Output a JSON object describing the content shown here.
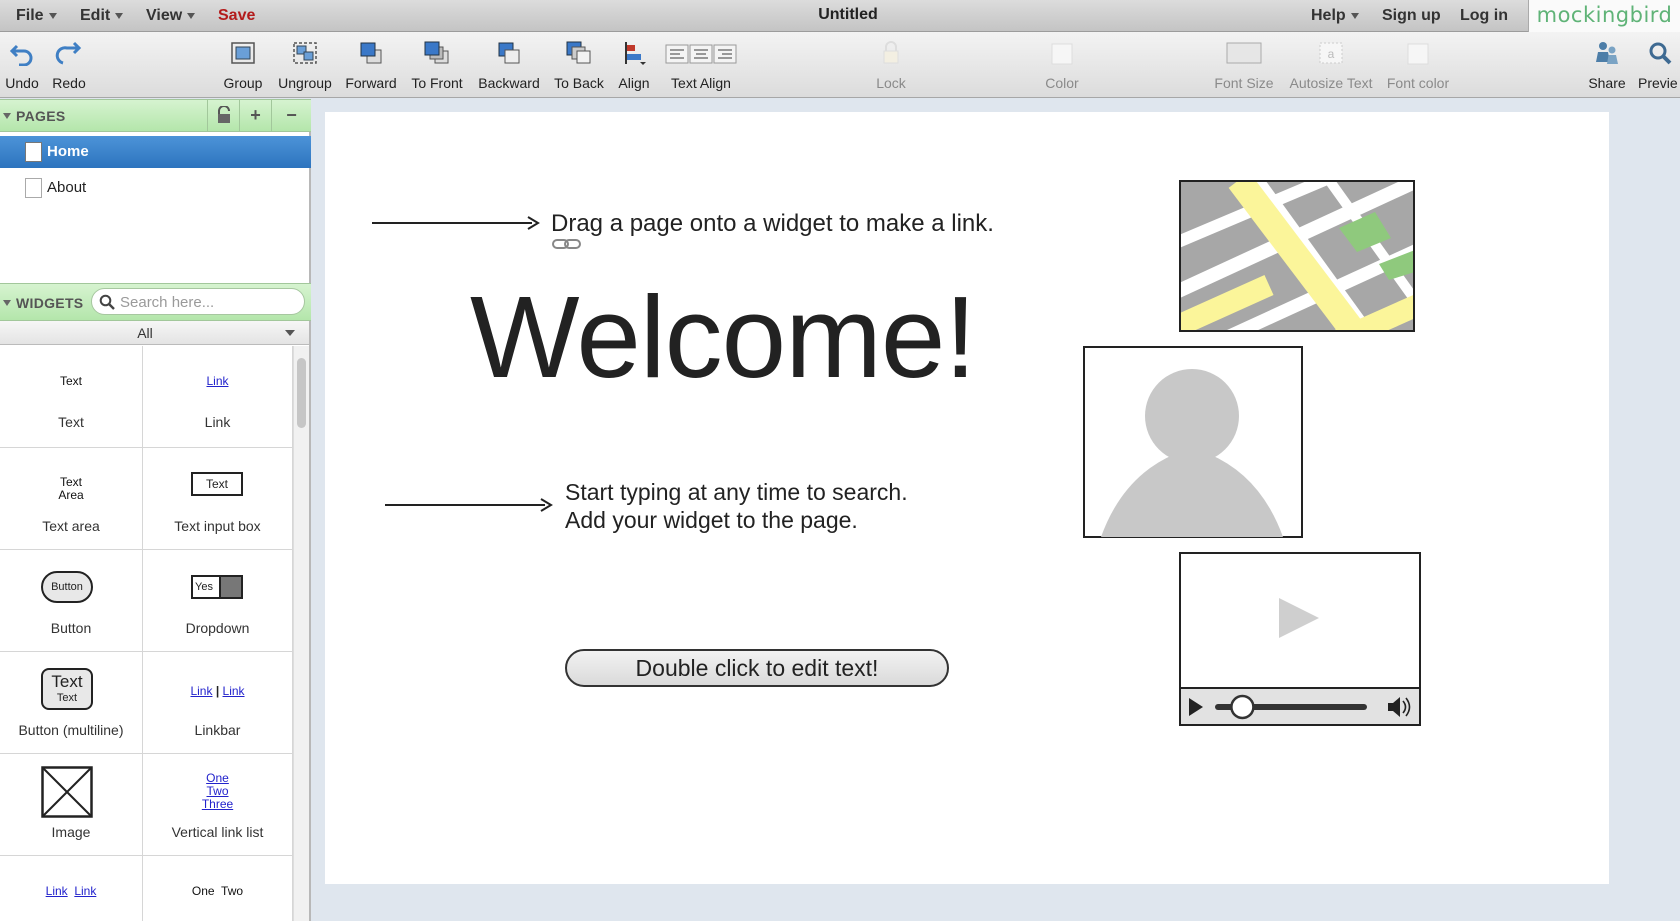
{
  "menubar": {
    "file": "File",
    "edit": "Edit",
    "view": "View",
    "save": "Save",
    "title": "Untitled",
    "help": "Help",
    "signup": "Sign up",
    "login": "Log in",
    "brand": "mockingbird"
  },
  "toolbar": {
    "undo": "Undo",
    "redo": "Redo",
    "group": "Group",
    "ungroup": "Ungroup",
    "forward": "Forward",
    "to_front": "To Front",
    "backward": "Backward",
    "to_back": "To Back",
    "align": "Align",
    "text_align": "Text Align",
    "lock": "Lock",
    "color": "Color",
    "font_size": "Font Size",
    "autosize_text": "Autosize Text",
    "font_color": "Font color",
    "share": "Share",
    "preview": "Previe"
  },
  "pages": {
    "title": "PAGES",
    "items": [
      {
        "label": "Home",
        "selected": true
      },
      {
        "label": "About",
        "selected": false
      }
    ]
  },
  "widgets": {
    "title": "WIDGETS",
    "search_placeholder": "Search here...",
    "filter": "All",
    "items": [
      {
        "label": "Text",
        "preview": "Text"
      },
      {
        "label": "Link",
        "preview": "Link"
      },
      {
        "label": "Text area",
        "preview": "Text\nArea"
      },
      {
        "label": "Text input box",
        "preview": "Text"
      },
      {
        "label": "Button",
        "preview": "Button"
      },
      {
        "label": "Dropdown",
        "preview": "Yes"
      },
      {
        "label": "Button (multiline)",
        "preview": "Text"
      },
      {
        "label": "Linkbar",
        "preview": "Link"
      },
      {
        "label": "Image",
        "preview": ""
      },
      {
        "label": "Vertical link list",
        "preview": "One"
      },
      {
        "label": "",
        "preview": "Link"
      },
      {
        "label": "",
        "preview": "One  Two"
      }
    ],
    "previews": {
      "text_input": "Text",
      "button": "Button",
      "dropdown": "Yes",
      "multiline_top": "Text",
      "multiline_bottom": "Text",
      "linkbar_a": "Link",
      "linkbar_b": "Link",
      "vlist_1": "One",
      "vlist_2": "Two",
      "vlist_3": "Three",
      "textarea_1": "Text",
      "textarea_2": "Area",
      "hlinks_a": "Link",
      "hlinks_b": "Link",
      "tabs": "One  Two"
    }
  },
  "canvas": {
    "drag_hint": "Drag a page onto a widget to make a link.",
    "welcome": "Welcome!",
    "search_hint_line1": "Start typing at any time to search.",
    "search_hint_line2": "Add your widget to the page.",
    "edit_button": "Double click to edit text!",
    "video_progress": 0.18
  },
  "colors": {
    "accent_green": "#5fb377",
    "selection_blue": "#3a84cc",
    "save_red": "#b31b1b",
    "link_blue": "#2222cc",
    "map_yellow": "#fbf59a",
    "map_green": "#8fc97d"
  }
}
